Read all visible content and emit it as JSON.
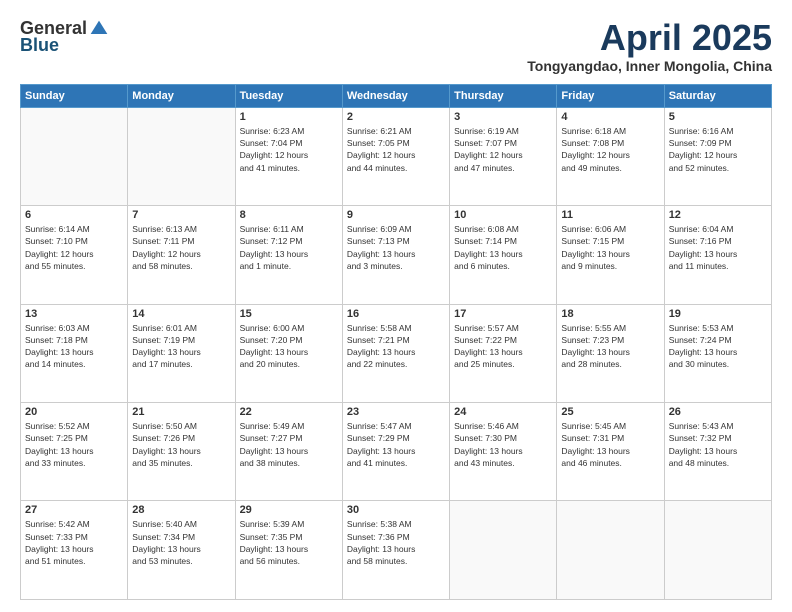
{
  "header": {
    "logo_general": "General",
    "logo_blue": "Blue",
    "month_title": "April 2025",
    "location": "Tongyangdao, Inner Mongolia, China"
  },
  "days_of_week": [
    "Sunday",
    "Monday",
    "Tuesday",
    "Wednesday",
    "Thursday",
    "Friday",
    "Saturday"
  ],
  "weeks": [
    [
      {
        "day": "",
        "info": ""
      },
      {
        "day": "",
        "info": ""
      },
      {
        "day": "1",
        "info": "Sunrise: 6:23 AM\nSunset: 7:04 PM\nDaylight: 12 hours\nand 41 minutes."
      },
      {
        "day": "2",
        "info": "Sunrise: 6:21 AM\nSunset: 7:05 PM\nDaylight: 12 hours\nand 44 minutes."
      },
      {
        "day": "3",
        "info": "Sunrise: 6:19 AM\nSunset: 7:07 PM\nDaylight: 12 hours\nand 47 minutes."
      },
      {
        "day": "4",
        "info": "Sunrise: 6:18 AM\nSunset: 7:08 PM\nDaylight: 12 hours\nand 49 minutes."
      },
      {
        "day": "5",
        "info": "Sunrise: 6:16 AM\nSunset: 7:09 PM\nDaylight: 12 hours\nand 52 minutes."
      }
    ],
    [
      {
        "day": "6",
        "info": "Sunrise: 6:14 AM\nSunset: 7:10 PM\nDaylight: 12 hours\nand 55 minutes."
      },
      {
        "day": "7",
        "info": "Sunrise: 6:13 AM\nSunset: 7:11 PM\nDaylight: 12 hours\nand 58 minutes."
      },
      {
        "day": "8",
        "info": "Sunrise: 6:11 AM\nSunset: 7:12 PM\nDaylight: 13 hours\nand 1 minute."
      },
      {
        "day": "9",
        "info": "Sunrise: 6:09 AM\nSunset: 7:13 PM\nDaylight: 13 hours\nand 3 minutes."
      },
      {
        "day": "10",
        "info": "Sunrise: 6:08 AM\nSunset: 7:14 PM\nDaylight: 13 hours\nand 6 minutes."
      },
      {
        "day": "11",
        "info": "Sunrise: 6:06 AM\nSunset: 7:15 PM\nDaylight: 13 hours\nand 9 minutes."
      },
      {
        "day": "12",
        "info": "Sunrise: 6:04 AM\nSunset: 7:16 PM\nDaylight: 13 hours\nand 11 minutes."
      }
    ],
    [
      {
        "day": "13",
        "info": "Sunrise: 6:03 AM\nSunset: 7:18 PM\nDaylight: 13 hours\nand 14 minutes."
      },
      {
        "day": "14",
        "info": "Sunrise: 6:01 AM\nSunset: 7:19 PM\nDaylight: 13 hours\nand 17 minutes."
      },
      {
        "day": "15",
        "info": "Sunrise: 6:00 AM\nSunset: 7:20 PM\nDaylight: 13 hours\nand 20 minutes."
      },
      {
        "day": "16",
        "info": "Sunrise: 5:58 AM\nSunset: 7:21 PM\nDaylight: 13 hours\nand 22 minutes."
      },
      {
        "day": "17",
        "info": "Sunrise: 5:57 AM\nSunset: 7:22 PM\nDaylight: 13 hours\nand 25 minutes."
      },
      {
        "day": "18",
        "info": "Sunrise: 5:55 AM\nSunset: 7:23 PM\nDaylight: 13 hours\nand 28 minutes."
      },
      {
        "day": "19",
        "info": "Sunrise: 5:53 AM\nSunset: 7:24 PM\nDaylight: 13 hours\nand 30 minutes."
      }
    ],
    [
      {
        "day": "20",
        "info": "Sunrise: 5:52 AM\nSunset: 7:25 PM\nDaylight: 13 hours\nand 33 minutes."
      },
      {
        "day": "21",
        "info": "Sunrise: 5:50 AM\nSunset: 7:26 PM\nDaylight: 13 hours\nand 35 minutes."
      },
      {
        "day": "22",
        "info": "Sunrise: 5:49 AM\nSunset: 7:27 PM\nDaylight: 13 hours\nand 38 minutes."
      },
      {
        "day": "23",
        "info": "Sunrise: 5:47 AM\nSunset: 7:29 PM\nDaylight: 13 hours\nand 41 minutes."
      },
      {
        "day": "24",
        "info": "Sunrise: 5:46 AM\nSunset: 7:30 PM\nDaylight: 13 hours\nand 43 minutes."
      },
      {
        "day": "25",
        "info": "Sunrise: 5:45 AM\nSunset: 7:31 PM\nDaylight: 13 hours\nand 46 minutes."
      },
      {
        "day": "26",
        "info": "Sunrise: 5:43 AM\nSunset: 7:32 PM\nDaylight: 13 hours\nand 48 minutes."
      }
    ],
    [
      {
        "day": "27",
        "info": "Sunrise: 5:42 AM\nSunset: 7:33 PM\nDaylight: 13 hours\nand 51 minutes."
      },
      {
        "day": "28",
        "info": "Sunrise: 5:40 AM\nSunset: 7:34 PM\nDaylight: 13 hours\nand 53 minutes."
      },
      {
        "day": "29",
        "info": "Sunrise: 5:39 AM\nSunset: 7:35 PM\nDaylight: 13 hours\nand 56 minutes."
      },
      {
        "day": "30",
        "info": "Sunrise: 5:38 AM\nSunset: 7:36 PM\nDaylight: 13 hours\nand 58 minutes."
      },
      {
        "day": "",
        "info": ""
      },
      {
        "day": "",
        "info": ""
      },
      {
        "day": "",
        "info": ""
      }
    ]
  ]
}
